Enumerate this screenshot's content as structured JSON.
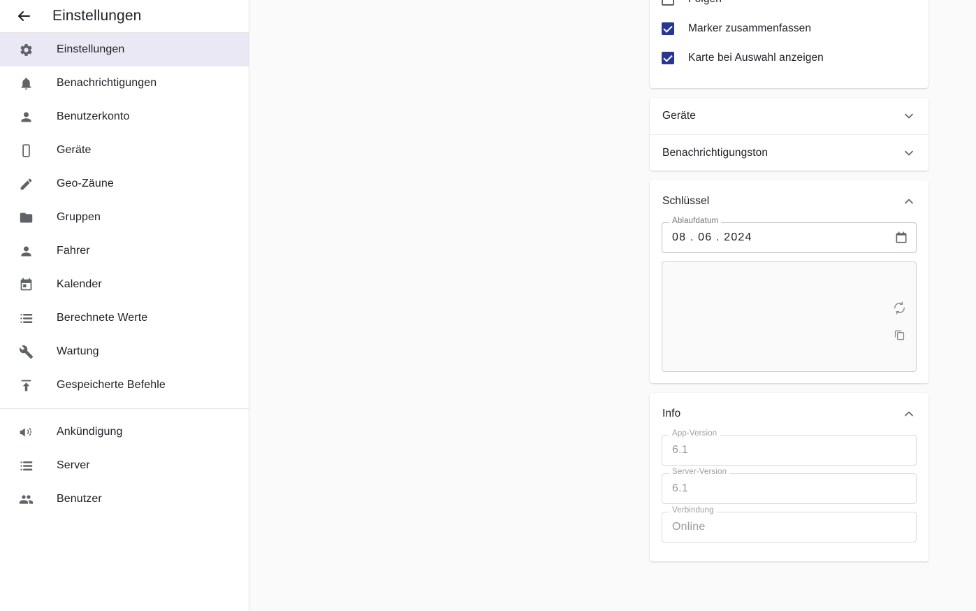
{
  "sidebar": {
    "header": {
      "back_icon": "arrow-back-icon",
      "title": "Einstellungen"
    },
    "items": [
      {
        "label": "Einstellungen",
        "icon": "gear-icon",
        "selected": true
      },
      {
        "label": "Benachrichtigungen",
        "icon": "bell-icon",
        "selected": false
      },
      {
        "label": "Benutzerkonto",
        "icon": "person-icon",
        "selected": false
      },
      {
        "label": "Geräte",
        "icon": "phone-icon",
        "selected": false
      },
      {
        "label": "Geo-Zäune",
        "icon": "pencil-icon",
        "selected": false
      },
      {
        "label": "Gruppen",
        "icon": "folder-icon",
        "selected": false
      },
      {
        "label": "Fahrer",
        "icon": "person-icon",
        "selected": false
      },
      {
        "label": "Kalender",
        "icon": "calendar-icon",
        "selected": false
      },
      {
        "label": "Berechnete Werte",
        "icon": "list-icon",
        "selected": false
      },
      {
        "label": "Wartung",
        "icon": "wrench-icon",
        "selected": false
      },
      {
        "label": "Gespeicherte Befehle",
        "icon": "upload-icon",
        "selected": false
      }
    ],
    "items_secondary": [
      {
        "label": "Ankündigung",
        "icon": "megaphone-icon"
      },
      {
        "label": "Server",
        "icon": "server-icon"
      },
      {
        "label": "Benutzer",
        "icon": "people-icon"
      }
    ]
  },
  "panel": {
    "checkboxes": [
      {
        "label": "Folgen",
        "checked": false
      },
      {
        "label": "Marker zusammenfassen",
        "checked": true
      },
      {
        "label": "Karte bei Auswahl anzeigen",
        "checked": true
      }
    ],
    "collapsed_sections": [
      {
        "title": "Geräte",
        "chevron": "chevron-down-icon"
      },
      {
        "title": "Benachrichtigungston",
        "chevron": "chevron-down-icon"
      }
    ],
    "key_section": {
      "title": "Schlüssel",
      "chevron": "chevron-up-icon",
      "expiry_field": {
        "label": "Ablaufdatum",
        "value": "08 . 06 . 2024",
        "icon": "calendar-icon"
      },
      "key_value": "",
      "actions": [
        {
          "icon": "refresh-icon"
        },
        {
          "icon": "copy-icon"
        }
      ]
    },
    "info_section": {
      "title": "Info",
      "chevron": "chevron-up-icon",
      "fields": [
        {
          "label": "App-Version",
          "value": "6.1"
        },
        {
          "label": "Server-Version",
          "value": "6.1"
        },
        {
          "label": "Verbindung",
          "value": "Online"
        }
      ]
    }
  },
  "colors": {
    "checkbox_checked": "#283593",
    "sidebar_selected": "#e9e8f4",
    "page_background": "#fafafa",
    "card_background": "#ffffff"
  }
}
